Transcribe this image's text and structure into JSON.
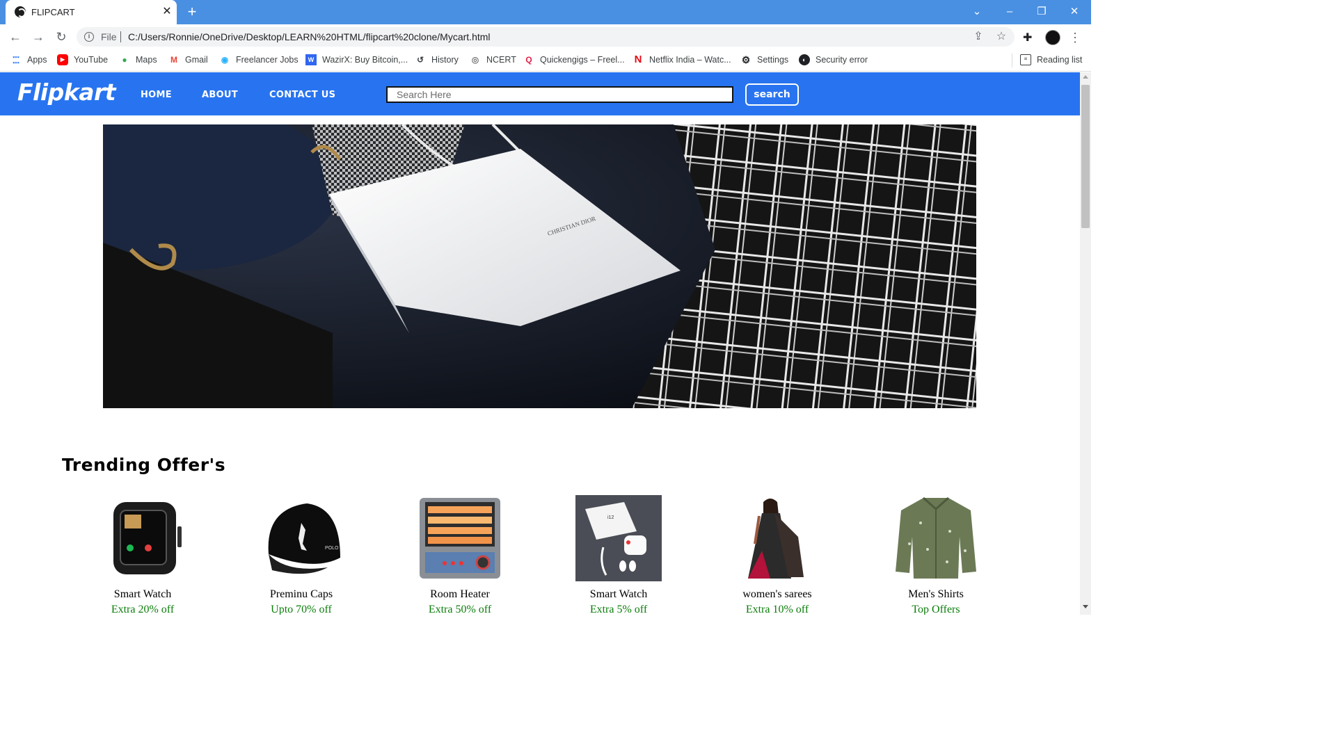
{
  "browser": {
    "tab_title": "FLIPCART",
    "file_label": "File",
    "url": "C:/Users/Ronnie/OneDrive/Desktop/LEARN%20HTML/flipcart%20clone/Mycart.html",
    "bookmarks": [
      {
        "label": "Apps",
        "icon": "apps-grid-icon"
      },
      {
        "label": "YouTube",
        "icon": "youtube-icon"
      },
      {
        "label": "Maps",
        "icon": "maps-pin-icon"
      },
      {
        "label": "Gmail",
        "icon": "gmail-icon"
      },
      {
        "label": "Freelancer Jobs",
        "icon": "freelancer-icon"
      },
      {
        "label": "WazirX: Buy Bitcoin,...",
        "icon": "wazirx-icon"
      },
      {
        "label": "History",
        "icon": "history-icon"
      },
      {
        "label": "NCERT",
        "icon": "ncert-icon"
      },
      {
        "label": "Quickengigs – Freel...",
        "icon": "quickengigs-icon"
      },
      {
        "label": "Netflix India – Watc...",
        "icon": "netflix-icon"
      },
      {
        "label": "Settings",
        "icon": "gear-icon"
      },
      {
        "label": "Security error",
        "icon": "globe-icon"
      }
    ],
    "reading_list": "Reading list"
  },
  "site": {
    "logo": "Flipkart",
    "nav": {
      "home": "HOME",
      "about": "ABOUT",
      "contact": "CONTACT US"
    },
    "search": {
      "placeholder": "Search Here",
      "button": "search"
    },
    "brand_color": "#2874f0"
  },
  "trending": {
    "title": "Trending Offer's",
    "products": [
      {
        "name": "Smart Watch",
        "offer": "Extra 20% off",
        "icon": "smartwatch-image"
      },
      {
        "name": "Preminu Caps",
        "offer": "Upto 70% off",
        "icon": "cap-image"
      },
      {
        "name": "Room Heater",
        "offer": "Extra 50% off",
        "icon": "room-heater-image"
      },
      {
        "name": "Smart Watch",
        "offer": "Extra 5% off",
        "icon": "earbuds-box-image"
      },
      {
        "name": "women's sarees",
        "offer": "Extra 10% off",
        "icon": "saree-image"
      },
      {
        "name": "Men's Shirts",
        "offer": "Top Offers",
        "icon": "shirt-image"
      }
    ]
  },
  "hero": {
    "bag_print": "CHRISTIAN DIOR"
  }
}
